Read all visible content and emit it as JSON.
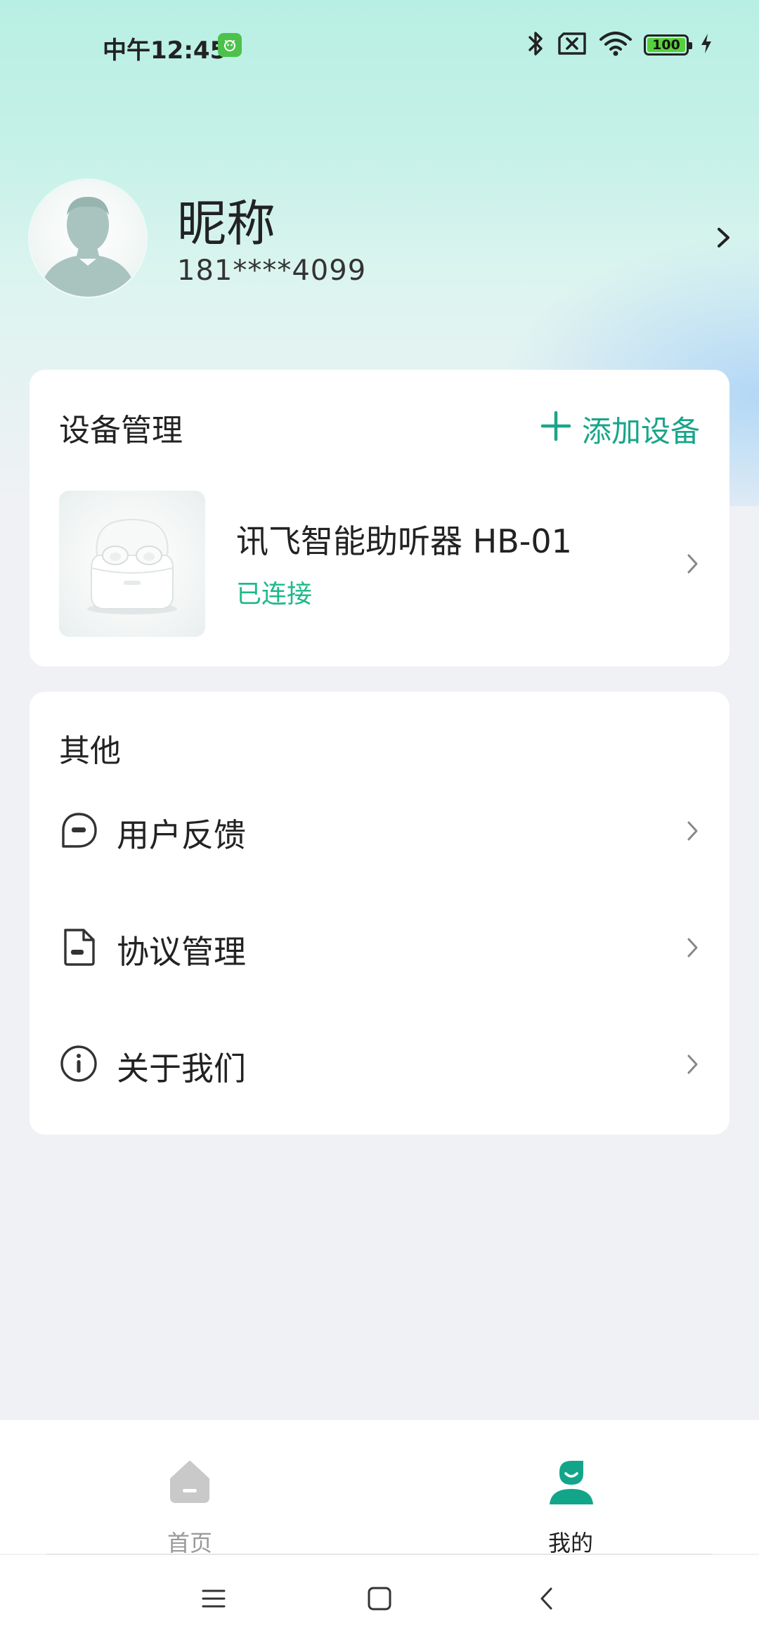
{
  "status_bar": {
    "time": "中午12:45",
    "battery": "100",
    "battery_level": 1.0,
    "icons": [
      "app-notification-icon",
      "bluetooth-icon",
      "no-sim-icon",
      "wifi-icon",
      "battery-icon",
      "charging-icon"
    ]
  },
  "profile": {
    "nickname": "昵称",
    "phone": "181****4099"
  },
  "device_card": {
    "title": "设备管理",
    "add_label": "添加设备",
    "device": {
      "name": "讯飞智能助听器 HB-01",
      "status": "已连接"
    }
  },
  "other_card": {
    "title": "其他",
    "items": [
      {
        "label": "用户反馈",
        "icon": "feedback-icon"
      },
      {
        "label": "协议管理",
        "icon": "document-icon"
      },
      {
        "label": "关于我们",
        "icon": "info-icon"
      }
    ]
  },
  "tabs": [
    {
      "label": "首页",
      "icon": "home-icon",
      "active": false
    },
    {
      "label": "我的",
      "icon": "user-icon",
      "active": true
    }
  ],
  "nav": [
    "menu-icon",
    "home-square-icon",
    "back-icon"
  ],
  "colors": {
    "accent": "#1aa58a",
    "connected": "#1db98a",
    "background": "#f0f1f5"
  }
}
